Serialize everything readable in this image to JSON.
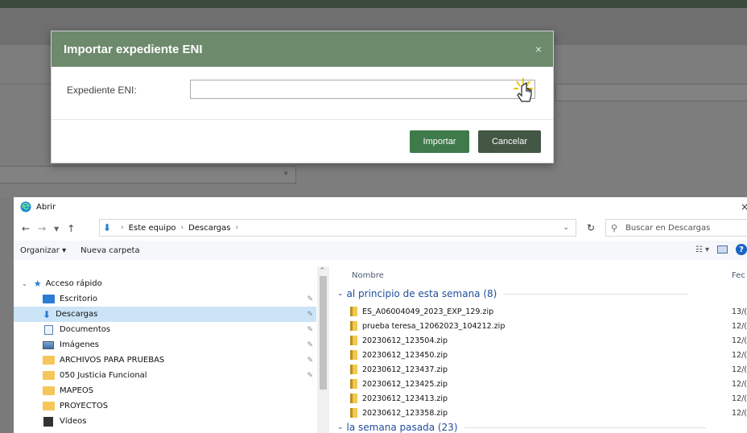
{
  "modal": {
    "title": "Importar expediente ENI",
    "close": "×",
    "field_label": "Expediente ENI:",
    "field_value": "",
    "import_label": "Importar",
    "cancel_label": "Cancelar"
  },
  "dialog": {
    "title": "Abrir",
    "close": "×",
    "breadcrumb": [
      "Este equipo",
      "Descargas"
    ],
    "search_placeholder": "Buscar en Descargas",
    "organize_label": "Organizar ▾",
    "new_folder_label": "Nueva carpeta",
    "help": "?",
    "col_name": "Nombre",
    "col_date": "Fec",
    "tree": [
      {
        "label": "Acceso rápido",
        "icon": "star-icon"
      },
      {
        "label": "Escritorio",
        "icon": "folder-blue-icon",
        "pinned": true
      },
      {
        "label": "Descargas",
        "icon": "download-icon",
        "pinned": true,
        "selected": true
      },
      {
        "label": "Documentos",
        "icon": "document-icon",
        "pinned": true
      },
      {
        "label": "Imágenes",
        "icon": "image-icon",
        "pinned": true
      },
      {
        "label": "ARCHIVOS PARA PRUEBAS",
        "icon": "folder-icon",
        "pinned": true
      },
      {
        "label": "050 Justicia Funcional",
        "icon": "folder-icon",
        "pinned": true
      },
      {
        "label": "MAPEOS",
        "icon": "folder-icon"
      },
      {
        "label": "PROYECTOS",
        "icon": "folder-icon"
      },
      {
        "label": "Vídeos",
        "icon": "video-icon"
      }
    ],
    "groups": [
      {
        "label": "al principio de esta semana (8)"
      },
      {
        "label": "la semana pasada (23)"
      }
    ],
    "files": [
      {
        "name": "ES_A06004049_2023_EXP_129.zip",
        "date": "13/("
      },
      {
        "name": "prueba teresa_12062023_104212.zip",
        "date": "12/("
      },
      {
        "name": "20230612_123504.zip",
        "date": "12/("
      },
      {
        "name": "20230612_123450.zip",
        "date": "12/("
      },
      {
        "name": "20230612_123437.zip",
        "date": "12/("
      },
      {
        "name": "20230612_123425.zip",
        "date": "12/("
      },
      {
        "name": "20230612_123413.zip",
        "date": "12/("
      },
      {
        "name": "20230612_123358.zip",
        "date": "12/("
      }
    ]
  },
  "colors": {
    "modal_header": "#6d8a6d",
    "import_button": "#3f7a4b",
    "cancel_button": "#445644",
    "selection": "#cce4f7",
    "group_text": "#1f4e9b"
  }
}
